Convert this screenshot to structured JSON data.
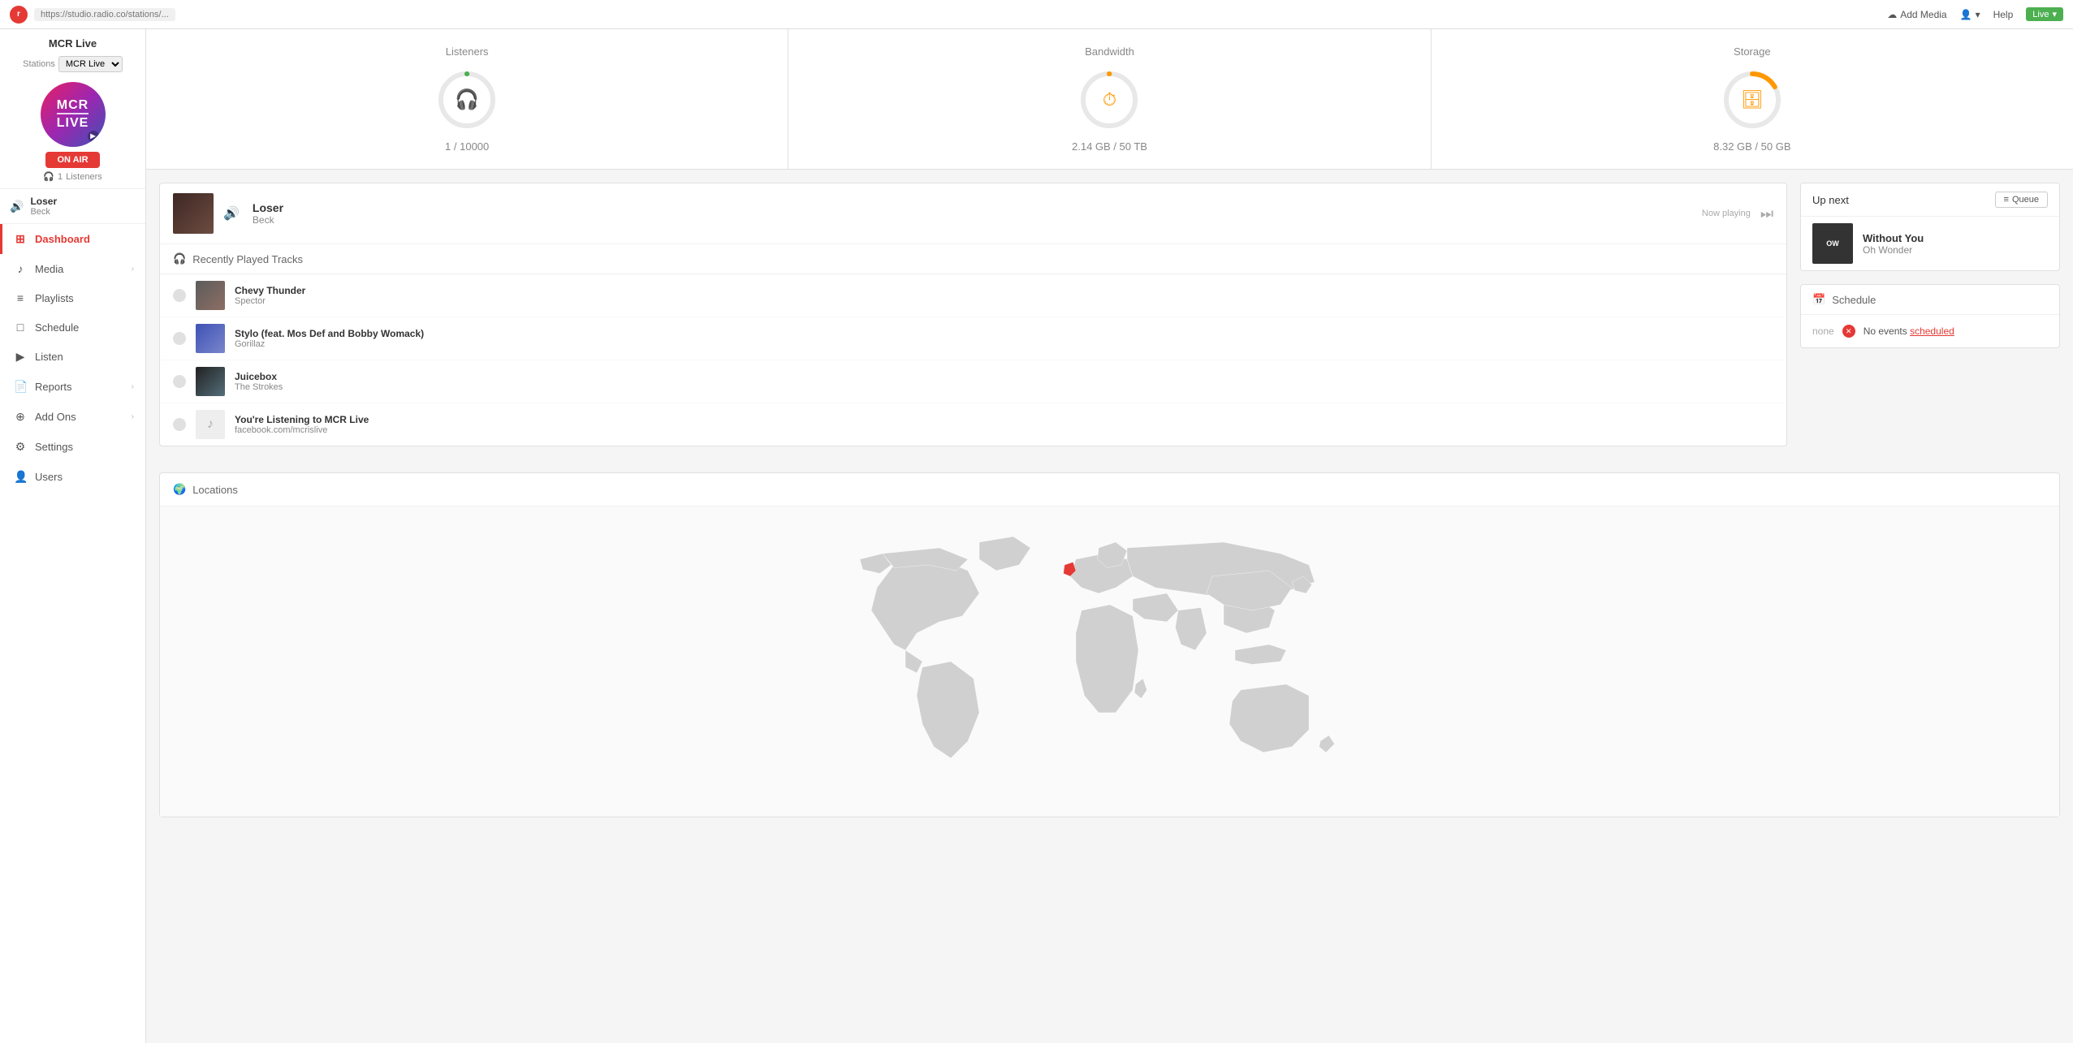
{
  "topbar": {
    "url": "https://studio.radio.co/stations/...",
    "logo_text": "r",
    "add_media_label": "Add Media",
    "help_label": "Help",
    "live_label": "Live"
  },
  "sidebar": {
    "station_name": "MCR Live",
    "stations_label": "Stations",
    "station_select": "MCR Live",
    "avatar_line1": "MCR",
    "avatar_line2": "LIVE",
    "on_air_label": "ON AIR",
    "listeners_count": "1",
    "listeners_label": "Listeners",
    "now_playing_title": "Loser",
    "now_playing_artist": "Beck",
    "nav": [
      {
        "id": "dashboard",
        "label": "Dashboard",
        "icon": "⊞",
        "active": true,
        "has_arrow": false
      },
      {
        "id": "media",
        "label": "Media",
        "icon": "♪",
        "active": false,
        "has_arrow": true
      },
      {
        "id": "playlists",
        "label": "Playlists",
        "icon": "≡",
        "active": false,
        "has_arrow": false
      },
      {
        "id": "schedule",
        "label": "Schedule",
        "icon": "□",
        "active": false,
        "has_arrow": false
      },
      {
        "id": "listen",
        "label": "Listen",
        "icon": "▶",
        "active": false,
        "has_arrow": false
      },
      {
        "id": "reports",
        "label": "Reports",
        "icon": "📄",
        "active": false,
        "has_arrow": true
      },
      {
        "id": "add-ons",
        "label": "Add Ons",
        "icon": "⊕",
        "active": false,
        "has_arrow": true
      },
      {
        "id": "settings",
        "label": "Settings",
        "icon": "⚙",
        "active": false,
        "has_arrow": false
      },
      {
        "id": "users",
        "label": "Users",
        "icon": "👤",
        "active": false,
        "has_arrow": false
      }
    ]
  },
  "stats": {
    "listeners": {
      "title": "Listeners",
      "value": "1 / 10000",
      "icon": "🎧",
      "icon_color": "#4caf50",
      "stroke_color": "#4caf50",
      "percent": 0.0001
    },
    "bandwidth": {
      "title": "Bandwidth",
      "value": "2.14 GB / 50 TB",
      "icon": "⏱",
      "icon_color": "#ff9800",
      "stroke_color": "#ff9800",
      "percent": 0.001
    },
    "storage": {
      "title": "Storage",
      "value": "8.32 GB / 50 GB",
      "icon": "🗄",
      "icon_color": "#ff9800",
      "stroke_color": "#ff9800",
      "percent": 0.166
    }
  },
  "now_playing": {
    "label": "Now playing",
    "title": "Loser",
    "artist": "Beck",
    "volume_icon": "🔊"
  },
  "recently_played": {
    "section_label": "Recently Played Tracks",
    "tracks": [
      {
        "title": "Chevy Thunder",
        "artist": "Spector",
        "thumb_class": "thumb-chevy"
      },
      {
        "title": "Stylo (feat. Mos Def and Bobby Womack)",
        "artist": "Gorillaz",
        "thumb_class": "thumb-stylo"
      },
      {
        "title": "Juicebox",
        "artist": "The Strokes",
        "thumb_class": "thumb-juicebox"
      },
      {
        "title": "You're Listening to MCR Live",
        "artist": "facebook.com/mcrislive",
        "thumb_class": "thumb-listening"
      }
    ]
  },
  "up_next": {
    "label": "Up next",
    "title": "Without You",
    "artist": "Oh Wonder",
    "album_text": "OW",
    "queue_label": "Queue"
  },
  "schedule": {
    "title": "Schedule",
    "none_label": "none",
    "no_events_text": "No events",
    "scheduled_link": "scheduled"
  },
  "locations": {
    "title": "Locations"
  }
}
